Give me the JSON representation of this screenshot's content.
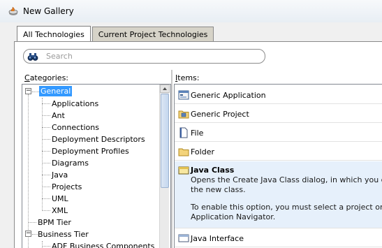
{
  "window": {
    "title": "New Gallery"
  },
  "tabs": [
    {
      "label": "All Technologies",
      "active": true
    },
    {
      "label": "Current Project Technologies",
      "active": false
    }
  ],
  "search": {
    "placeholder": "Search"
  },
  "categories": {
    "label_prefix": "C",
    "label_rest": "ategories:",
    "tree": [
      {
        "label": "General",
        "level": 0,
        "expanded": true,
        "selected": true
      },
      {
        "label": "Applications",
        "level": 1
      },
      {
        "label": "Ant",
        "level": 1
      },
      {
        "label": "Connections",
        "level": 1
      },
      {
        "label": "Deployment Descriptors",
        "level": 1
      },
      {
        "label": "Deployment Profiles",
        "level": 1
      },
      {
        "label": "Diagrams",
        "level": 1
      },
      {
        "label": "Java",
        "level": 1
      },
      {
        "label": "Projects",
        "level": 1
      },
      {
        "label": "UML",
        "level": 1
      },
      {
        "label": "XML",
        "level": 1
      },
      {
        "label": "BPM Tier",
        "level": 0
      },
      {
        "label": "Business Tier",
        "level": 0,
        "expanded": true
      },
      {
        "label": "ADF Business Components",
        "level": 1
      }
    ]
  },
  "items": {
    "label_prefix": "I",
    "label_rest": "tems:",
    "list": [
      {
        "label": "Generic Application",
        "icon": "application-icon"
      },
      {
        "label": "Generic Project",
        "icon": "project-icon"
      },
      {
        "label": "File",
        "icon": "file-icon"
      },
      {
        "label": "Folder",
        "icon": "folder-icon"
      }
    ],
    "selected": {
      "label": "Java Class",
      "icon": "java-class-icon",
      "desc_line1": "Opens the Create Java Class dialog, in which you define s",
      "desc_line2": "the new class.",
      "desc_line3": "To enable this option, you must select a project or a file w",
      "desc_line4": "Application Navigator."
    },
    "after": [
      {
        "label": "Java Interface",
        "icon": "java-interface-icon"
      }
    ]
  },
  "colors": {
    "selection": "#3399ff",
    "selected_item_bg": "#e6f0fb"
  }
}
